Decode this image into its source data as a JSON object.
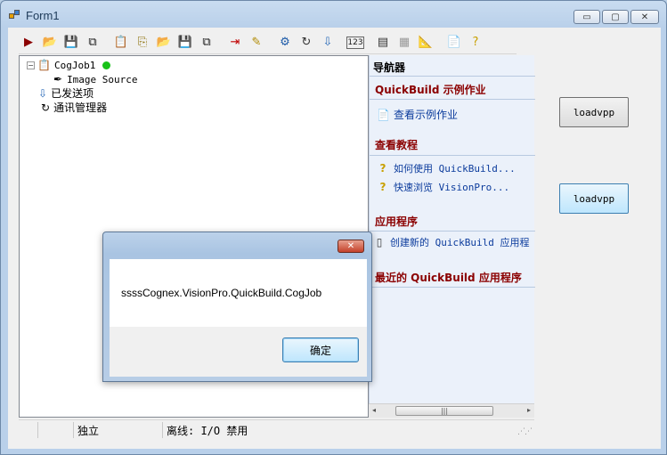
{
  "window": {
    "title": "Form1",
    "minimize_glyph": "▭",
    "maximize_glyph": "▢",
    "close_glyph": "✕"
  },
  "toolbar": {
    "icons": [
      {
        "name": "run-icon",
        "glyph": "▶",
        "color": "#8b0000"
      },
      {
        "name": "open-folder-icon",
        "glyph": "📂",
        "color": "#c8a000"
      },
      {
        "name": "save-icon",
        "glyph": "💾",
        "color": "#1a1a1a"
      },
      {
        "name": "save-as-icon",
        "glyph": "⧉",
        "color": "#1a1a1a"
      },
      {
        "name": "job-properties-icon",
        "glyph": "📋",
        "color": "#8a6d00"
      },
      {
        "name": "job-copy-icon",
        "glyph": "⎘",
        "color": "#8a6d00"
      },
      {
        "name": "open-job-icon",
        "glyph": "📂",
        "color": "#c8a000"
      },
      {
        "name": "save-job-icon",
        "glyph": "💾",
        "color": "#1a1a1a"
      },
      {
        "name": "save-job-as-icon",
        "glyph": "⧉",
        "color": "#1a1a1a"
      },
      {
        "name": "send-icon",
        "glyph": "⇥",
        "color": "#c00000"
      },
      {
        "name": "edit-icon",
        "glyph": "✎",
        "color": "#b08a00"
      },
      {
        "name": "settings-icon",
        "glyph": "⚙",
        "color": "#1c5aa8"
      },
      {
        "name": "refresh-icon",
        "glyph": "↻",
        "color": "#333333"
      },
      {
        "name": "download-icon",
        "glyph": "⇩",
        "color": "#2a6ab8"
      },
      {
        "name": "counter-icon",
        "glyph": "123",
        "color": "#1a1a1a"
      },
      {
        "name": "terminal-icon",
        "glyph": "▤",
        "color": "#333333"
      },
      {
        "name": "grid-icon",
        "glyph": "▦",
        "color": "#999999"
      },
      {
        "name": "measure-icon",
        "glyph": "📐",
        "color": "#333333"
      },
      {
        "name": "document-icon",
        "glyph": "📄",
        "color": "#555555"
      },
      {
        "name": "help-icon",
        "glyph": "?",
        "color": "#c8a000"
      }
    ]
  },
  "tree": {
    "job_label": "CogJob1",
    "image_source_label": "Image Source",
    "sent_items_label": "已发送项",
    "comm_manager_label": "通讯管理器",
    "expander_glyph": "−"
  },
  "navigator": {
    "header": "导航器",
    "sections": {
      "examples_title": "QuickBuild 示例作业",
      "examples_link": "查看示例作业",
      "tutorials_title": "查看教程",
      "tutorial_link_1": "如何使用 QuickBuild...",
      "tutorial_link_2": "快速浏览 VisionPro...",
      "apps_title": "应用程序",
      "apps_link": "创建新的 QuickBuild 应用程",
      "recent_title": "最近的 QuickBuild 应用程序"
    }
  },
  "scrollbar": {
    "left_arrow": "◂",
    "right_arrow": "▸",
    "grip": "|||"
  },
  "side_buttons": {
    "button1_label": "loadvpp",
    "button2_label": "loadvpp"
  },
  "statusbar": {
    "cell2": "独立",
    "cell3": "离线: I/O 禁用"
  },
  "dialog": {
    "message": "ssssCognex.VisionPro.QuickBuild.CogJob",
    "ok_label": "确定",
    "close_glyph": "✕"
  }
}
